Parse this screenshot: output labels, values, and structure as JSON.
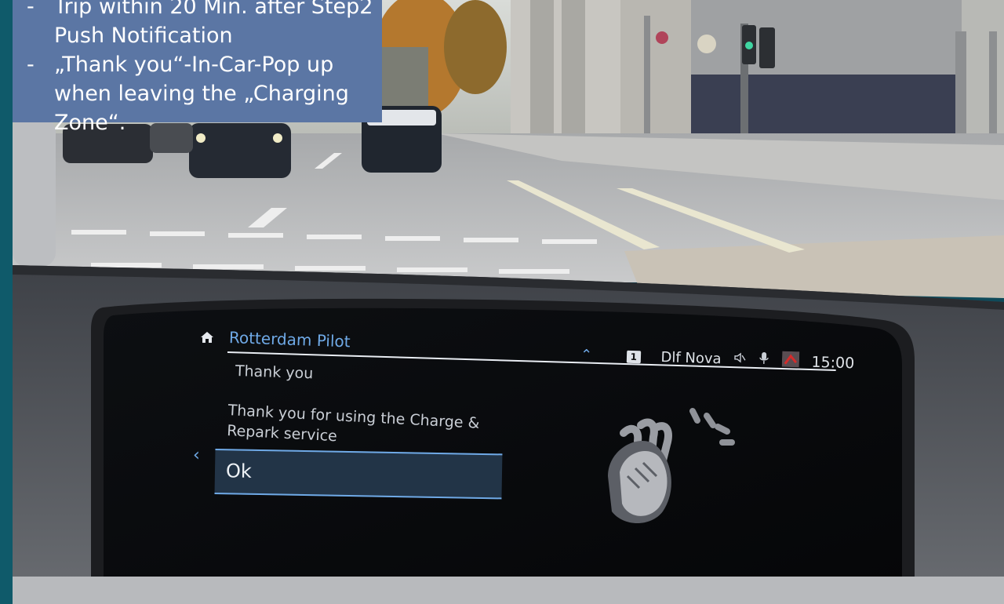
{
  "slide": {
    "bullets": [
      {
        "dash": "-",
        "text": "Trip within 20 Min. after Step2 Push Notification"
      },
      {
        "dash": "-",
        "text": "„Thank you“-In-Car-Pop up when leaving the „Charging Zone“."
      }
    ],
    "box_color": "#5b76a4",
    "frame_color": "#0f5a6a"
  },
  "car_screen": {
    "app_title": "Rotterdam Pilot",
    "status": {
      "source_number": "1",
      "station": "Dlf Nova",
      "time": "15:00"
    },
    "dialog": {
      "heading": "Thank you",
      "message": "Thank you for using the Charge & Repark service",
      "ok_label": "Ok"
    },
    "icons": [
      "home-icon",
      "chevron-up-icon",
      "mute-icon",
      "microphone-icon",
      "map-icon",
      "back-chevron-icon",
      "clapping-hands-icon"
    ],
    "accent_color": "#6fa9e6"
  }
}
